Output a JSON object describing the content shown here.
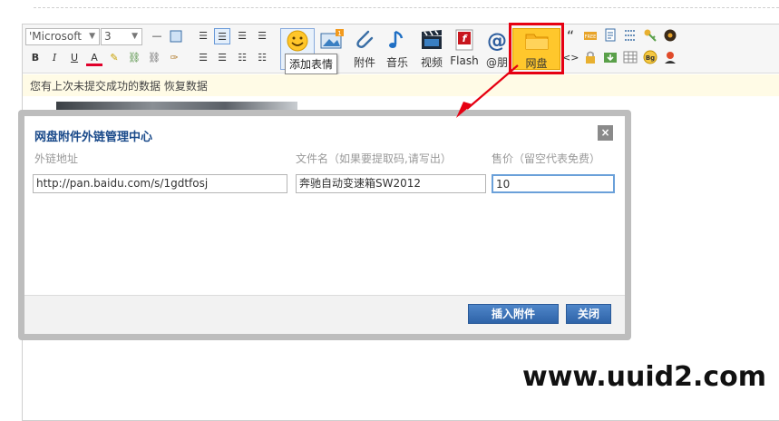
{
  "editor": {
    "font_family": "'Microsoft",
    "font_size": "3",
    "buttons": {
      "emoticon": "表情",
      "image": "图片",
      "attachment": "附件",
      "music": "音乐",
      "video": "视频",
      "flash": "Flash",
      "mention": "@朋",
      "netdisk": "网盘"
    },
    "format_buttons": [
      "B",
      "I",
      "U",
      "A"
    ],
    "tooltip": "添加表情"
  },
  "restore_bar": {
    "message": "您有上次未提交成功的数据",
    "link": "恢复数据"
  },
  "dialog": {
    "title": "网盘附件外链管理中心",
    "columns": {
      "url_label": "外链地址",
      "filename_label": "文件名（如果要提取码,请写出）",
      "price_label": "售价（留空代表免费）"
    },
    "values": {
      "url": "http://pan.baidu.com/s/1gdtfosj",
      "filename": "奔驰自动变速箱SW2012",
      "price": "10"
    },
    "buttons": {
      "insert": "插入附件",
      "close": "关闭"
    },
    "close_icon": "×"
  },
  "watermark": "www.uuid2.com",
  "colors": {
    "highlight": "#e60012",
    "title_blue": "#1a4a8a",
    "button_blue": "#2e63a8"
  }
}
